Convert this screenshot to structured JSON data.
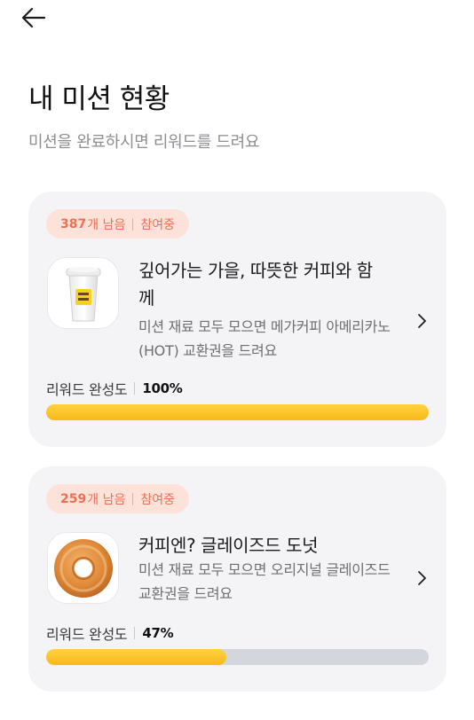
{
  "header": {
    "back_icon": "arrow-left-icon",
    "title": "내 미션 현황",
    "subtitle": "미션을 완료하시면 리워드를 드려요"
  },
  "missions": [
    {
      "remaining_count": "387",
      "remaining_unit": "개 남음",
      "status": "참여중",
      "thumb_icon": "coffee-cup-icon",
      "title": "깊어가는 가을, 따뜻한 커피와 함께",
      "description": "미션 재료 모두 모으면 메가커피 아메리카노(HOT) 교환권을 드려요",
      "progress_label": "리워드 완성도",
      "progress_text": "100%",
      "progress": 1.0
    },
    {
      "remaining_count": "259",
      "remaining_unit": "개 남음",
      "status": "참여중",
      "thumb_icon": "donut-icon",
      "title": "커피엔? 글레이즈드 도넛",
      "description": "미션 재료 모두 모으면 오리지널 글레이즈드 교환권을 드려요",
      "progress_label": "리워드 완성도",
      "progress_text": "47%",
      "progress": 0.47
    }
  ],
  "colors": {
    "badge_bg": "#fde2da",
    "badge_text": "#ec6f53",
    "progress_fill": "#fcc21f",
    "progress_track": "#d3d6dc",
    "card_bg": "#f4f4f6"
  }
}
